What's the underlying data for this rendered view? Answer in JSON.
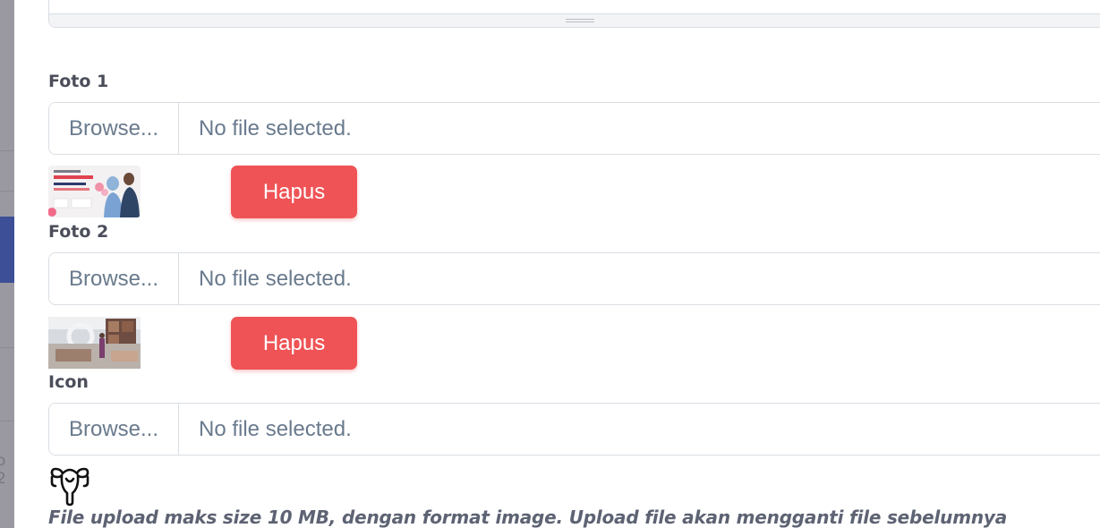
{
  "form": {
    "fields": [
      {
        "label": "Foto 1",
        "browse_label": "Browse...",
        "status": "No file selected.",
        "delete_label": "Hapus",
        "preview": "banner-image"
      },
      {
        "label": "Foto 2",
        "browse_label": "Browse...",
        "status": "No file selected.",
        "delete_label": "Hapus",
        "preview": "room-photo"
      },
      {
        "label": "Icon",
        "browse_label": "Browse...",
        "status": "No file selected.",
        "preview": "uterus-icon"
      }
    ],
    "help_text": "File upload maks size 10 MB, dengan format image. Upload file akan mengganti file sebelumnya"
  },
  "thumbnail_banner": {
    "line1": "Harapan Baru Untuk",
    "line2": "PEJUANG GARIS DUA"
  },
  "colors": {
    "danger": "#ef5356",
    "label": "#4b4e5a",
    "text": "#697a8d",
    "border": "#d9dee3"
  }
}
